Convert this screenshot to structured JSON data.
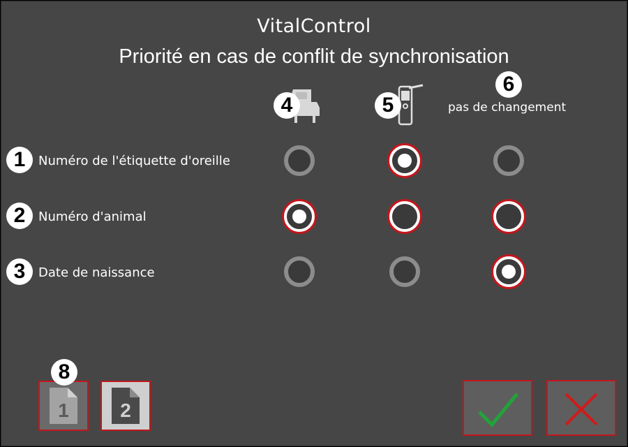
{
  "header": {
    "app_title": "VitalControl",
    "subtitle": "Priorité en cas de conflit de synchronisation"
  },
  "markers": [
    "1",
    "2",
    "3",
    "4",
    "5",
    "6",
    "8"
  ],
  "columns": [
    {
      "icon": "feeding-station-icon",
      "label": ""
    },
    {
      "icon": "handheld-scanner-icon",
      "label": ""
    },
    {
      "icon": "",
      "label": "pas de changement"
    }
  ],
  "rows": [
    {
      "label": "Numéro de l'étiquette d'oreille",
      "options": [
        "disabled",
        "selected",
        "disabled"
      ]
    },
    {
      "label": "Numéro d'animal",
      "options": [
        "selected",
        "enabled",
        "enabled"
      ]
    },
    {
      "label": "Date de naissance",
      "options": [
        "disabled",
        "disabled",
        "selected"
      ]
    }
  ],
  "pages": [
    {
      "label": "1",
      "active": true
    },
    {
      "label": "2",
      "active": false
    }
  ],
  "colors": {
    "background": "#464646",
    "accent": "#c4161c",
    "confirm": "#22a33a",
    "cancel": "#d11a1a"
  },
  "actions": {
    "confirm": "check-icon",
    "cancel": "close-icon"
  }
}
